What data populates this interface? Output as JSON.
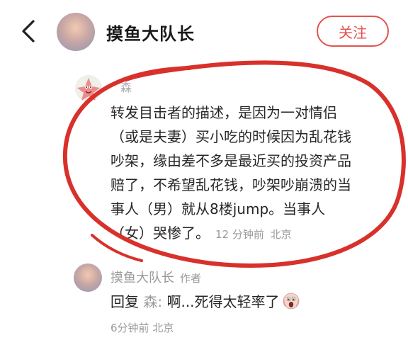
{
  "header": {
    "title": "摸鱼大队长",
    "follow_label": "关注"
  },
  "comment1": {
    "username": "森",
    "lines": [
      "转发目击者的描述，是因为一对情侣",
      "（或是夫妻）买小吃的时候因为乱花钱",
      "吵架，缘由差不多是最近买的投资产品",
      "赔了，不希望乱花钱，吵架吵崩溃的当",
      "事人（男）就从8楼jump。当事人",
      "（女）哭惨了。"
    ],
    "time": "12 分钟前",
    "location": "北京"
  },
  "comment2": {
    "username": "摸鱼大队长",
    "author_tag": "作者",
    "reply_prefix": "回复",
    "reply_to": "森:",
    "text": "啊...死得太轻率了",
    "time": "6分钟前",
    "location": "北京"
  },
  "icons": {
    "back": "chevron-left-icon",
    "emoji": "screaming-face-emoji-icon"
  },
  "colors": {
    "accent": "#e3524f",
    "annotation_circle": "#d8312b",
    "muted_text": "#9a9a9a"
  }
}
